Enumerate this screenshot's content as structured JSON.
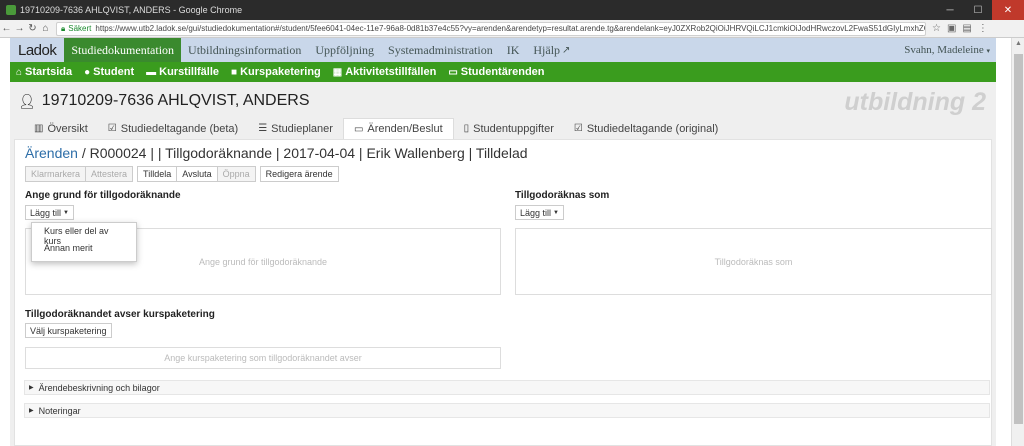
{
  "browser": {
    "window_title": "19710209-7636 AHLQVIST, ANDERS - Google Chrome",
    "secure_label": "Säkert",
    "url": "https://www.utb2.ladok.se/gui/studiedokumentation#/student/5fee6041-04ec-11e7-96a8-0d81b37e4c55?vy=arenden&arendetyp=resultat.arende.tg&arendelank=eyJ0ZXRob2QiOiJHRVQiLCJ1cmkiOiJodHRwczovL2FwaS51dGIyLmxhZG9rLnNlOjQ0My9zZX"
  },
  "topnav": {
    "logo": "Ladok",
    "items": [
      "Studiedokumentation",
      "Utbildningsinformation",
      "Uppföljning",
      "Systemadministration",
      "IK",
      "Hjälp"
    ],
    "user": "Svahn, Madeleine"
  },
  "subnav": {
    "items": [
      "Startsida",
      "Student",
      "Kurstillfälle",
      "Kurspaketering",
      "Aktivitetstillfällen",
      "Studentärenden"
    ]
  },
  "student": {
    "name": "19710209-7636 AHLQVIST, ANDERS",
    "environment": "utbildning 2"
  },
  "tabs": [
    "Översikt",
    "Studiedeltagande (beta)",
    "Studieplaner",
    "Ärenden/Beslut",
    "Studentuppgifter",
    "Studiedeltagande (original)"
  ],
  "breadcrumb": {
    "link": "Ärenden",
    "rest": " / R000024 | | Tillgodoräknande | 2017-04-04 | Erik Wallenberg | Tilldelad"
  },
  "actions": {
    "group1": [
      "Klarmarkera",
      "Attestera"
    ],
    "group2": [
      "Tilldela",
      "Avsluta",
      "Öppna"
    ],
    "edit": "Redigera ärende"
  },
  "grund": {
    "title": "Ange grund för tillgodoräknande",
    "add_label": "Lägg till",
    "placeholder": "Ange grund för tillgodoräknande",
    "menu": [
      "Kurs eller del av kurs",
      "Annan merit"
    ]
  },
  "tillgodo": {
    "title": "Tillgodoräknas som",
    "add_label": "Lägg till",
    "placeholder": "Tillgodoräknas som"
  },
  "kurspaketering": {
    "title": "Tillgodoräknandet avser kurspaketering",
    "button": "Välj kurspaketering",
    "placeholder": "Ange kurspaketering som tillgodoräknandet avser"
  },
  "sections": [
    "Ärendebeskrivning och bilagor",
    "Noteringar"
  ]
}
